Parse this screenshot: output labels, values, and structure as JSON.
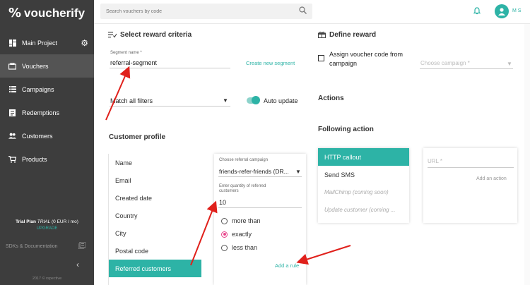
{
  "brand": {
    "logo_mark": "%",
    "name": "voucherify"
  },
  "sidebar": {
    "items": [
      {
        "label": "Main Project",
        "icon": "dashboard-icon"
      },
      {
        "label": "Vouchers",
        "icon": "vouchers-icon"
      },
      {
        "label": "Campaigns",
        "icon": "campaigns-icon"
      },
      {
        "label": "Redemptions",
        "icon": "redemptions-icon"
      },
      {
        "label": "Customers",
        "icon": "customers-icon"
      },
      {
        "label": "Products",
        "icon": "cart-icon"
      }
    ],
    "plan_prefix": "Trial Plan",
    "plan_status": "TRIAL",
    "plan_price": "(0 EUR / mo)",
    "upgrade_label": "UPGRADE",
    "sdk_label": "SDKs & Documentation",
    "copyright": "2017 © rspective"
  },
  "topbar": {
    "search_placeholder": "Search vouchers by code",
    "user_initials": "M S"
  },
  "reward_criteria": {
    "title": "Select reward criteria",
    "segment_label": "Segment name *",
    "segment_value": "referral-segment",
    "create_segment_link": "Create new segment",
    "match_filter": "Match all filters",
    "auto_update_label": "Auto update",
    "customer_profile_title": "Customer profile",
    "profile_items": [
      "Name",
      "Email",
      "Created date",
      "Country",
      "City",
      "Postal code",
      "Referred customers"
    ],
    "referral_campaign_label": "Choose referral campaign",
    "referral_campaign_value": "friends-refer-friends (DR...",
    "quantity_label_line1": "Enter quantity of referred",
    "quantity_label_line2": "customers",
    "quantity_value": "10",
    "options": [
      "more than",
      "exactly",
      "less than"
    ],
    "selected_option": "exactly",
    "add_rule_link": "Add a rule"
  },
  "define_reward": {
    "title": "Define reward",
    "assign_label_line1": "Assign voucher code from",
    "assign_label_line2": "campaign",
    "campaign_placeholder": "Choose campaign *",
    "actions_title": "Actions",
    "following_action_title": "Following action",
    "following_actions": [
      {
        "label": "HTTP callout",
        "state": "active"
      },
      {
        "label": "Send SMS",
        "state": "normal"
      },
      {
        "label": "MailChimp (coming soon)",
        "state": "disabled"
      },
      {
        "label": "Update customer (coming ...",
        "state": "disabled"
      }
    ],
    "url_placeholder": "URL *",
    "add_action_link": "Add an action"
  },
  "colors": {
    "sidebar": "#3d3d3d",
    "accent": "#2db3a6",
    "radio_selected": "#e8458b",
    "annotation_arrow": "#e0201b"
  }
}
